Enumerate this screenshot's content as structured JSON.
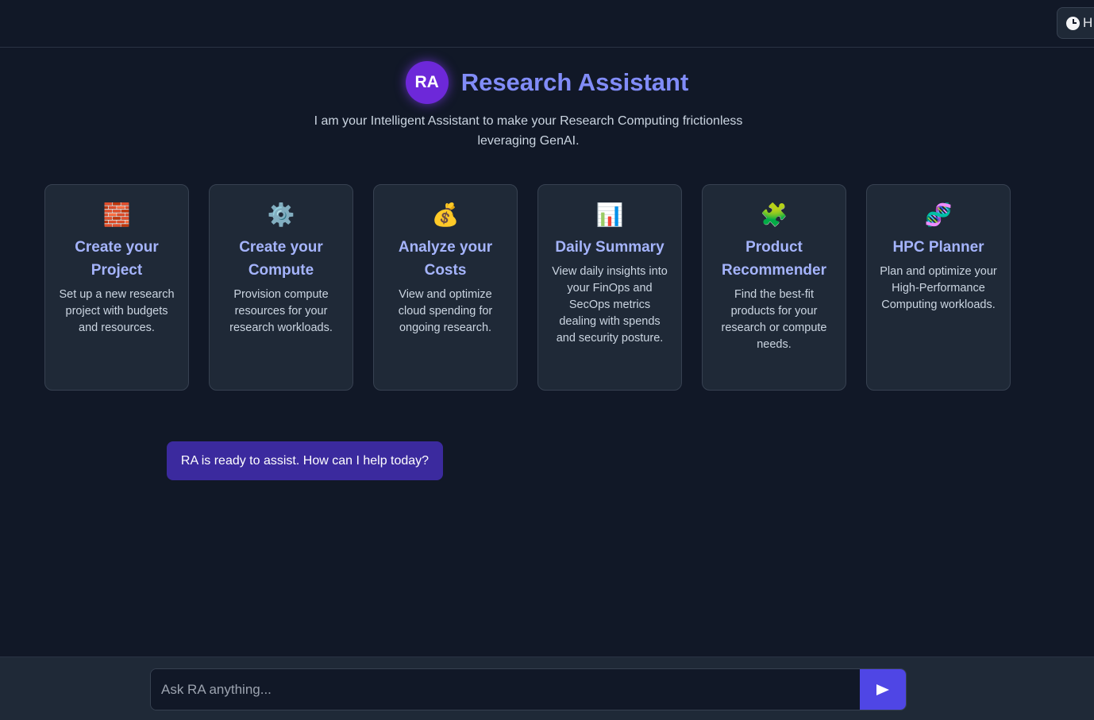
{
  "topbar": {
    "history_label": "H",
    "history_icon": "clock-icon"
  },
  "header": {
    "avatar_initials": "RA",
    "title": "Research Assistant",
    "subtitle_line1": "I am your Intelligent Assistant to make your Research Computing frictionless",
    "subtitle_line2": "leveraging GenAI."
  },
  "cards": [
    {
      "icon": "🧱",
      "icon_name": "bricks-icon",
      "title": "Create your Project",
      "description": "Set up a new research project with budgets and resources."
    },
    {
      "icon": "⚙️",
      "icon_name": "gear-icon",
      "title": "Create your Compute",
      "description": "Provision compute resources for your research workloads."
    },
    {
      "icon": "💰",
      "icon_name": "money-bag-icon",
      "title": "Analyze your Costs",
      "description": "View and optimize cloud spending for ongoing research."
    },
    {
      "icon": "📊",
      "icon_name": "bar-chart-icon",
      "title": "Daily Summary",
      "description": "View daily insights into your FinOps and SecOps metrics dealing with spends and security posture."
    },
    {
      "icon": "🧩",
      "icon_name": "puzzle-icon",
      "title": "Product Recommender",
      "description": "Find the best-fit products for your research or compute needs."
    },
    {
      "icon": "🧬",
      "icon_name": "dna-icon",
      "title": "HPC Planner",
      "description": "Plan and optimize your High-Performance Computing workloads."
    }
  ],
  "chat": {
    "assistant_message": "RA is ready to assist. How can I help today?"
  },
  "footer": {
    "input_placeholder": "Ask RA anything...",
    "input_value": "",
    "send_icon": "send-arrow-icon"
  },
  "colors": {
    "background": "#111827",
    "card": "#1f2937",
    "accent": "#818cf8",
    "button": "#4f46e5",
    "bubble": "#3b2a9e"
  }
}
